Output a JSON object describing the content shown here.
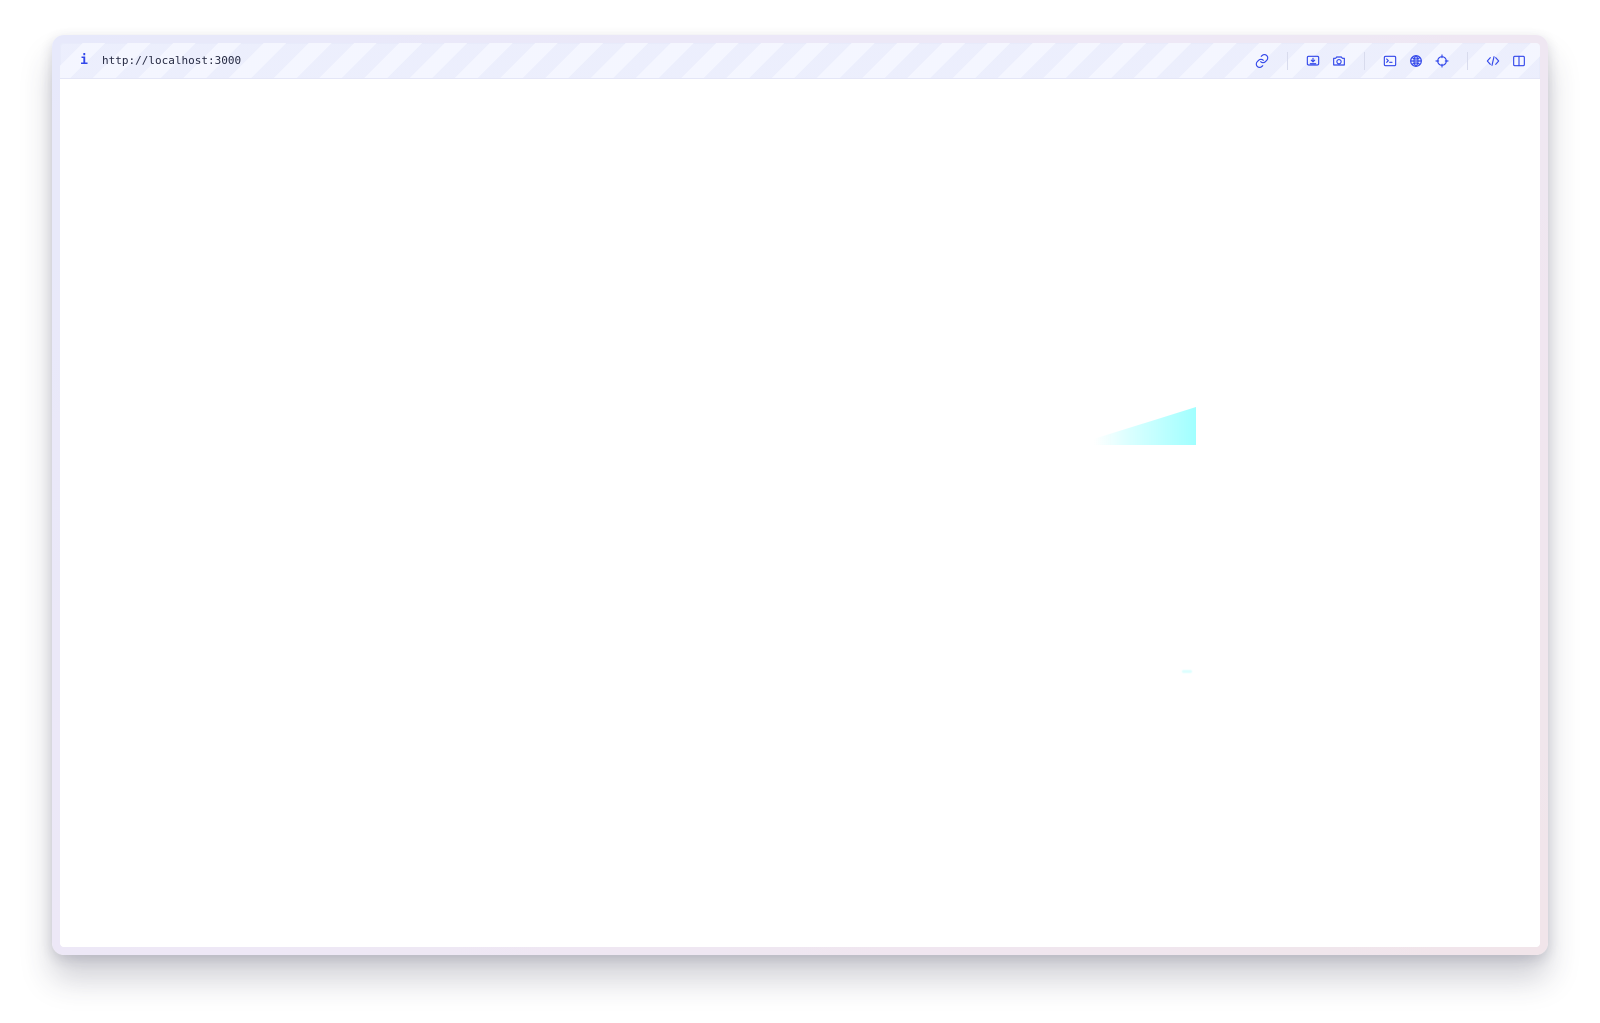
{
  "colors": {
    "accent": "#3247ea",
    "text": "#262a43",
    "window_border": "#e7e9fb",
    "highlight": "#7cffff"
  },
  "toolbar": {
    "url": "http://localhost:3000",
    "info_icon_text": "i",
    "icons": [
      "link-icon",
      "download-preview-icon",
      "camera-icon",
      "terminal-icon",
      "globe-icon",
      "crosshair-icon",
      "code-icon",
      "split-view-icon"
    ]
  }
}
